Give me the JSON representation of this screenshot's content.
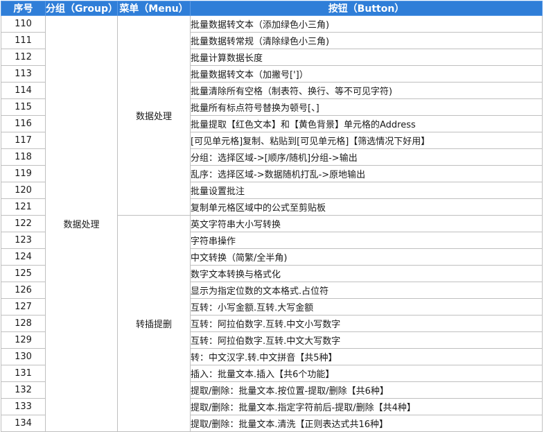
{
  "headers": {
    "seq": "序号",
    "group": "分组（Group）",
    "menu": "菜单（Menu）",
    "button": "按钮（Button）"
  },
  "group_label": "数据处理",
  "menus": [
    {
      "label": "数据处理",
      "rows": 12
    },
    {
      "label": "转插提删",
      "rows": 13
    }
  ],
  "rows": [
    {
      "seq": "110",
      "button": "批量数据转文本（添加绿色小三角)"
    },
    {
      "seq": "111",
      "button": "批量数据转常规（清除绿色小三角)"
    },
    {
      "seq": "112",
      "button": "批量计算数据长度"
    },
    {
      "seq": "113",
      "button": "批量数据转文本（加撇号[']）"
    },
    {
      "seq": "114",
      "button": "批量清除所有空格（制表符、换行、等不可见字符)"
    },
    {
      "seq": "115",
      "button": "批量所有标点符号替换为顿号[、]"
    },
    {
      "seq": "116",
      "button": "批量提取【红色文本】和【黄色背景】单元格的Address"
    },
    {
      "seq": "117",
      "button": "[可见单元格]复制、粘贴到[可见单元格]【筛选情况下好用】"
    },
    {
      "seq": "118",
      "button": "分组：选择区域->[顺序/随机]分组->输出"
    },
    {
      "seq": "119",
      "button": "乱序：选择区域->数据随机打乱->原地输出"
    },
    {
      "seq": "120",
      "button": "批量设置批注"
    },
    {
      "seq": "121",
      "button": "复制单元格区域中的公式至剪贴板"
    },
    {
      "seq": "122",
      "button": "英文字符串大小写转换"
    },
    {
      "seq": "123",
      "button": "字符串操作"
    },
    {
      "seq": "124",
      "button": "中文转换（简繁/全半角)"
    },
    {
      "seq": "125",
      "button": "数字文本转换与格式化"
    },
    {
      "seq": "126",
      "button": "显示为指定位数的文本格式.占位符"
    },
    {
      "seq": "127",
      "button": "互转：小写金额.互转.大写金额"
    },
    {
      "seq": "128",
      "button": "互转：阿拉伯数字.互转.中文小写数字"
    },
    {
      "seq": "129",
      "button": "互转：阿拉伯数字.互转.中文大写数字"
    },
    {
      "seq": "130",
      "button": "转：中文汉字.转.中文拼音【共5种】"
    },
    {
      "seq": "131",
      "button": "插入：批量文本.插入【共6个功能】"
    },
    {
      "seq": "132",
      "button": "提取/删除：批量文本.按位置-提取/删除【共6种】"
    },
    {
      "seq": "133",
      "button": "提取/删除：批量文本.指定字符前后-提取/删除【共4种】"
    },
    {
      "seq": "134",
      "button": "提取/删除：批量文本.清洗【正则表达式共16种】"
    }
  ]
}
